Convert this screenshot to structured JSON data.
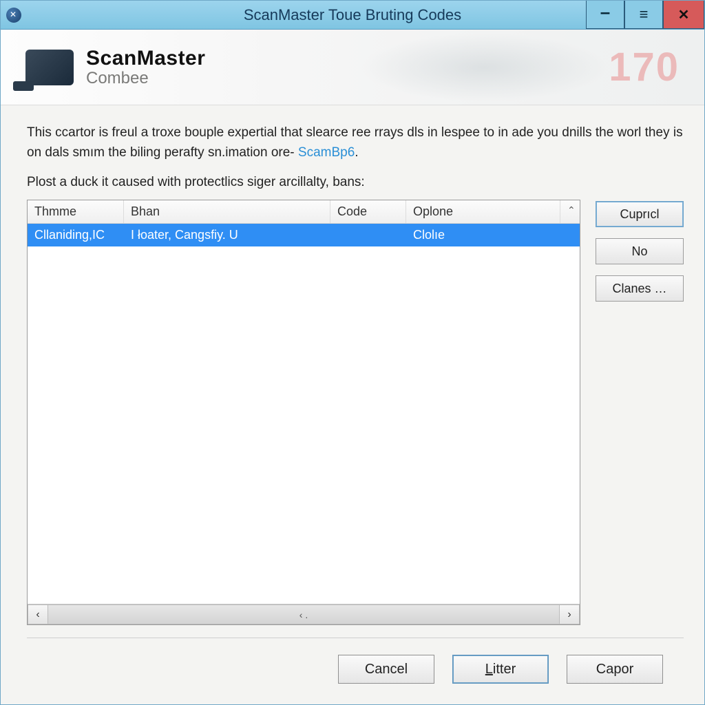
{
  "window": {
    "title": "ScanMaster Toue Bruting Codes"
  },
  "banner": {
    "logo_line1": "ScanMaster",
    "logo_line2": "Combee",
    "big_number": "170"
  },
  "intro": {
    "text_before_link": "This ccartor is freul a troxe bouple expertial that slearce ree rrays dls in lespee to in ade you dnills the worl they is on dals smım the biling perafty sn.imation ore- ",
    "link_text": "ScamBp6",
    "text_after_link": "."
  },
  "sub_intro": "Plost a duck it caused with protectlics siger arcillalty, bans:",
  "table": {
    "columns": {
      "thmme": "Thmme",
      "bhan": "Bhan",
      "code": "Code",
      "oplone": "Oplone"
    },
    "scroll_up_glyph": "⌃",
    "rows": [
      {
        "thmme": "Cllaniding,IC",
        "bhan": "I łoater, Cangsfiy. U",
        "code": "",
        "oplone": "Clolıe"
      }
    ],
    "hscroll": {
      "left": "‹",
      "right": "›",
      "mid": "‹ ."
    }
  },
  "side_buttons": {
    "cupricl": "Cuprıcl",
    "no": "No",
    "clanes": "Clanes …"
  },
  "footer": {
    "cancel": "Cancel",
    "litter_prefix": "L",
    "litter_rest": "itter",
    "capor": "Capor"
  }
}
